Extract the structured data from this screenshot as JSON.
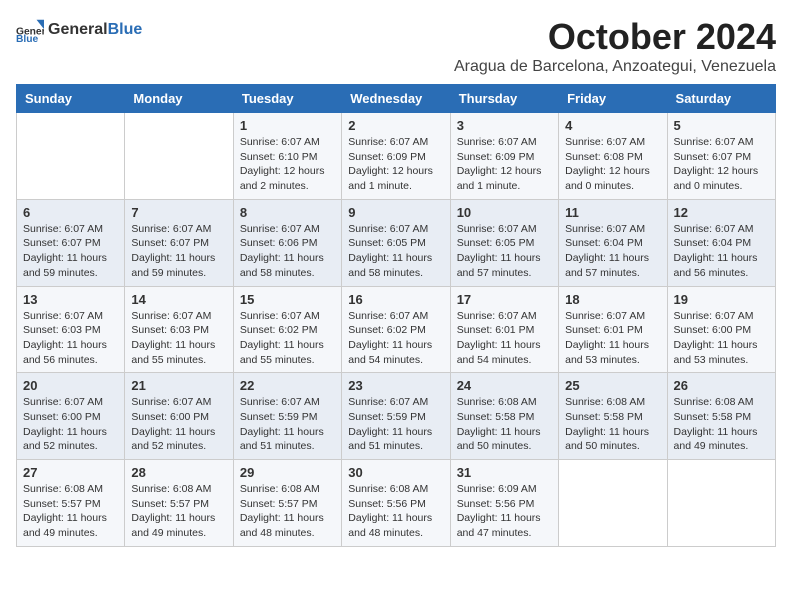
{
  "header": {
    "logo_general": "General",
    "logo_blue": "Blue",
    "month_title": "October 2024",
    "location": "Aragua de Barcelona, Anzoategui, Venezuela"
  },
  "days_of_week": [
    "Sunday",
    "Monday",
    "Tuesday",
    "Wednesday",
    "Thursday",
    "Friday",
    "Saturday"
  ],
  "weeks": [
    [
      {
        "day": "",
        "info": ""
      },
      {
        "day": "",
        "info": ""
      },
      {
        "day": "1",
        "info": "Sunrise: 6:07 AM\nSunset: 6:10 PM\nDaylight: 12 hours\nand 2 minutes."
      },
      {
        "day": "2",
        "info": "Sunrise: 6:07 AM\nSunset: 6:09 PM\nDaylight: 12 hours\nand 1 minute."
      },
      {
        "day": "3",
        "info": "Sunrise: 6:07 AM\nSunset: 6:09 PM\nDaylight: 12 hours\nand 1 minute."
      },
      {
        "day": "4",
        "info": "Sunrise: 6:07 AM\nSunset: 6:08 PM\nDaylight: 12 hours\nand 0 minutes."
      },
      {
        "day": "5",
        "info": "Sunrise: 6:07 AM\nSunset: 6:07 PM\nDaylight: 12 hours\nand 0 minutes."
      }
    ],
    [
      {
        "day": "6",
        "info": "Sunrise: 6:07 AM\nSunset: 6:07 PM\nDaylight: 11 hours\nand 59 minutes."
      },
      {
        "day": "7",
        "info": "Sunrise: 6:07 AM\nSunset: 6:07 PM\nDaylight: 11 hours\nand 59 minutes."
      },
      {
        "day": "8",
        "info": "Sunrise: 6:07 AM\nSunset: 6:06 PM\nDaylight: 11 hours\nand 58 minutes."
      },
      {
        "day": "9",
        "info": "Sunrise: 6:07 AM\nSunset: 6:05 PM\nDaylight: 11 hours\nand 58 minutes."
      },
      {
        "day": "10",
        "info": "Sunrise: 6:07 AM\nSunset: 6:05 PM\nDaylight: 11 hours\nand 57 minutes."
      },
      {
        "day": "11",
        "info": "Sunrise: 6:07 AM\nSunset: 6:04 PM\nDaylight: 11 hours\nand 57 minutes."
      },
      {
        "day": "12",
        "info": "Sunrise: 6:07 AM\nSunset: 6:04 PM\nDaylight: 11 hours\nand 56 minutes."
      }
    ],
    [
      {
        "day": "13",
        "info": "Sunrise: 6:07 AM\nSunset: 6:03 PM\nDaylight: 11 hours\nand 56 minutes."
      },
      {
        "day": "14",
        "info": "Sunrise: 6:07 AM\nSunset: 6:03 PM\nDaylight: 11 hours\nand 55 minutes."
      },
      {
        "day": "15",
        "info": "Sunrise: 6:07 AM\nSunset: 6:02 PM\nDaylight: 11 hours\nand 55 minutes."
      },
      {
        "day": "16",
        "info": "Sunrise: 6:07 AM\nSunset: 6:02 PM\nDaylight: 11 hours\nand 54 minutes."
      },
      {
        "day": "17",
        "info": "Sunrise: 6:07 AM\nSunset: 6:01 PM\nDaylight: 11 hours\nand 54 minutes."
      },
      {
        "day": "18",
        "info": "Sunrise: 6:07 AM\nSunset: 6:01 PM\nDaylight: 11 hours\nand 53 minutes."
      },
      {
        "day": "19",
        "info": "Sunrise: 6:07 AM\nSunset: 6:00 PM\nDaylight: 11 hours\nand 53 minutes."
      }
    ],
    [
      {
        "day": "20",
        "info": "Sunrise: 6:07 AM\nSunset: 6:00 PM\nDaylight: 11 hours\nand 52 minutes."
      },
      {
        "day": "21",
        "info": "Sunrise: 6:07 AM\nSunset: 6:00 PM\nDaylight: 11 hours\nand 52 minutes."
      },
      {
        "day": "22",
        "info": "Sunrise: 6:07 AM\nSunset: 5:59 PM\nDaylight: 11 hours\nand 51 minutes."
      },
      {
        "day": "23",
        "info": "Sunrise: 6:07 AM\nSunset: 5:59 PM\nDaylight: 11 hours\nand 51 minutes."
      },
      {
        "day": "24",
        "info": "Sunrise: 6:08 AM\nSunset: 5:58 PM\nDaylight: 11 hours\nand 50 minutes."
      },
      {
        "day": "25",
        "info": "Sunrise: 6:08 AM\nSunset: 5:58 PM\nDaylight: 11 hours\nand 50 minutes."
      },
      {
        "day": "26",
        "info": "Sunrise: 6:08 AM\nSunset: 5:58 PM\nDaylight: 11 hours\nand 49 minutes."
      }
    ],
    [
      {
        "day": "27",
        "info": "Sunrise: 6:08 AM\nSunset: 5:57 PM\nDaylight: 11 hours\nand 49 minutes."
      },
      {
        "day": "28",
        "info": "Sunrise: 6:08 AM\nSunset: 5:57 PM\nDaylight: 11 hours\nand 49 minutes."
      },
      {
        "day": "29",
        "info": "Sunrise: 6:08 AM\nSunset: 5:57 PM\nDaylight: 11 hours\nand 48 minutes."
      },
      {
        "day": "30",
        "info": "Sunrise: 6:08 AM\nSunset: 5:56 PM\nDaylight: 11 hours\nand 48 minutes."
      },
      {
        "day": "31",
        "info": "Sunrise: 6:09 AM\nSunset: 5:56 PM\nDaylight: 11 hours\nand 47 minutes."
      },
      {
        "day": "",
        "info": ""
      },
      {
        "day": "",
        "info": ""
      }
    ]
  ]
}
